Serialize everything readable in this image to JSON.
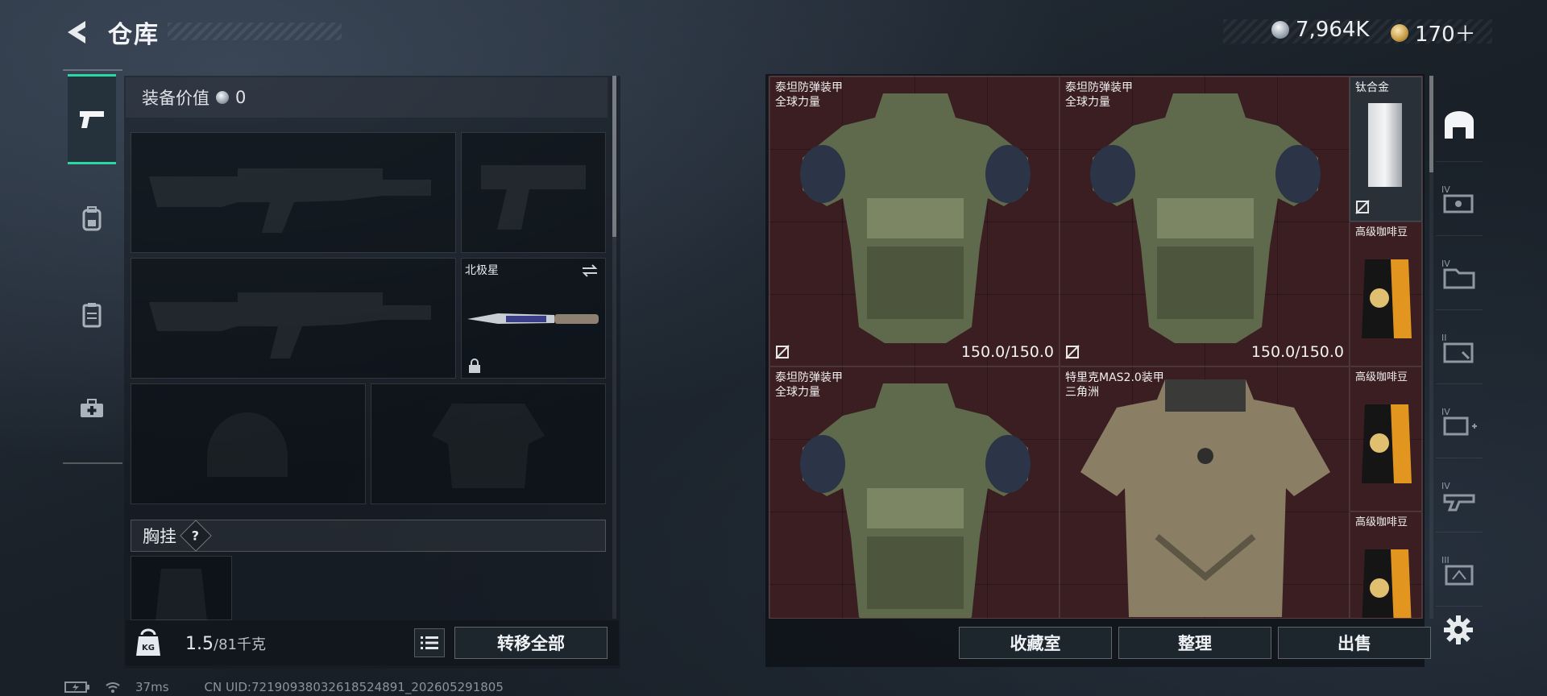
{
  "header": {
    "title": "仓库",
    "currency": [
      {
        "icon": "silver-coin-icon",
        "amount": "7,964K"
      },
      {
        "icon": "gold-coin-icon",
        "amount": "170＋"
      }
    ]
  },
  "side_nav": [
    {
      "icon": "pistol-icon",
      "active": true
    },
    {
      "icon": "backpack-icon",
      "active": false
    },
    {
      "icon": "vest-icon",
      "active": false
    },
    {
      "icon": "medkit-icon",
      "active": false
    }
  ],
  "loadout": {
    "value_label": "装备价值",
    "value": "0",
    "slots": {
      "primary_1": {
        "icon": "rifle-icon"
      },
      "sidearm": {
        "icon": "pistol-icon"
      },
      "primary_2": {
        "icon": "rifle-icon"
      },
      "melee": {
        "name": "北极星",
        "icon": "knife-icon",
        "locked": true
      },
      "helmet": {
        "icon": "helmet-icon"
      },
      "armor": {
        "icon": "armor-icon"
      }
    },
    "chest_rig_label": "胸挂",
    "chest_rig_help": "?",
    "weight": "1.5",
    "weight_cap": "/81千克",
    "transfer_all": "转移全部"
  },
  "storage": {
    "items": [
      {
        "name_1": "泰坦防弹装甲",
        "name_2": "全球力量",
        "durability": "150.0/150.0",
        "type": "titan-armor"
      },
      {
        "name_1": "泰坦防弹装甲",
        "name_2": "全球力量",
        "durability": "150.0/150.0",
        "type": "titan-armor"
      },
      {
        "name_1": "钛合金",
        "type": "titanium-plate"
      },
      {
        "name_1": "高级咖啡豆",
        "type": "coffee-bag"
      },
      {
        "name_1": "泰坦防弹装甲",
        "name_2": "全球力量",
        "type": "titan-armor"
      },
      {
        "name_1": "特里克MAS2.0装甲",
        "name_2": "三角洲",
        "type": "camo-armor"
      },
      {
        "name_1": "高级咖啡豆",
        "type": "coffee-bag"
      },
      {
        "name_1": "高级咖啡豆",
        "type": "coffee-bag"
      }
    ],
    "buttons": {
      "collection": "收藏室",
      "organize": "整理",
      "sell": "出售"
    }
  },
  "right_nav": [
    {
      "icon": "storage-home-icon"
    },
    {
      "label": "IV",
      "icon": "ammo-box-icon"
    },
    {
      "label": "IV",
      "icon": "folder-icon"
    },
    {
      "label": "II",
      "icon": "card-icon"
    },
    {
      "label": "IV",
      "icon": "medical-icon"
    },
    {
      "label": "IV",
      "icon": "gun-case-icon"
    },
    {
      "label": "III",
      "icon": "box-icon"
    }
  ],
  "status_bar": {
    "ping": "37ms",
    "uid": "CN UID:72190938032618524891_202605291805"
  },
  "colors": {
    "accent": "#2ad8a4",
    "grid_bg": "#3a1e22"
  }
}
